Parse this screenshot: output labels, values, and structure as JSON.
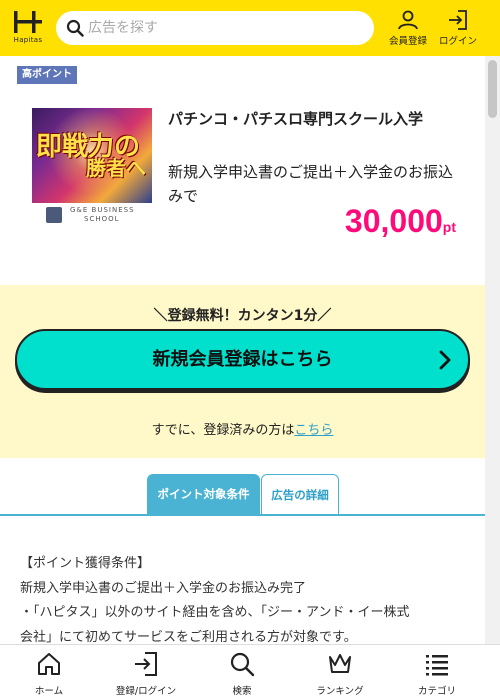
{
  "header": {
    "logo_text": "Hapitas",
    "search_placeholder": "広告を探す",
    "member_register": "会員登録",
    "login": "ログイン"
  },
  "offer": {
    "badge": "高ポイント",
    "title": "パチンコ・パチスロ専門スクール入学",
    "description": "新規入学申込書のご提出＋入学金のお振込みで",
    "points_value": "30,000",
    "points_unit": "pt",
    "thumbnail": {
      "headline_1": "即戦力の",
      "headline_2": "勝者へ",
      "brand_line_1": "G&E BUSINESS",
      "brand_line_2": "SCHOOL"
    }
  },
  "register": {
    "tagline": "＼登録無料！カンタン1分／",
    "button_label": "新規会員登録はこちら",
    "already_text": "すでに、登録済みの方は",
    "already_link": "こちら"
  },
  "tabs": [
    {
      "label": "ポイント対象条件",
      "active": true
    },
    {
      "label": "広告の詳細",
      "active": false
    }
  ],
  "conditions": {
    "heading": "【ポイント獲得条件】",
    "line_1": "新規入学申込書のご提出＋入学金のお振込み完了",
    "line_2": "・「ハピタス」以外のサイト経由を含め、「ジー・アンド・イー株式",
    "line_3": "会社」にて初めてサービスをご利用される方が対象です。"
  },
  "bottom_nav": {
    "home": "ホーム",
    "login": "登録/ログイン",
    "search": "検索",
    "ranking": "ランキング",
    "category": "カテゴリ"
  },
  "colors": {
    "header_bg": "#ffe000",
    "badge_bg": "#5e76b8",
    "points": "#ff0a7a",
    "register_band": "#fff8c9",
    "register_button": "#00e0cc",
    "tab_accent": "#4ab3d3",
    "link": "#2a9fc9"
  },
  "icons": {
    "search": "search-icon",
    "member": "person-icon",
    "login": "login-arrow-icon",
    "chevron": "chevron-right-icon",
    "home": "home-icon",
    "ranking": "crown-icon",
    "category": "list-icon"
  }
}
